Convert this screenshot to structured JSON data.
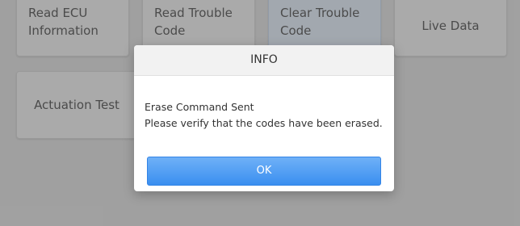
{
  "tiles": [
    {
      "label_line1": "Read ECU",
      "label_line2": "Information"
    },
    {
      "label_line1": "Read Trouble",
      "label_line2": "Code"
    },
    {
      "label_line1": "Clear Trouble",
      "label_line2": "Code"
    },
    {
      "label": "Live Data"
    },
    {
      "label": "Actuation Test"
    }
  ],
  "dialog": {
    "title": "INFO",
    "message_line1": "Erase Command Sent",
    "message_line2": "Please verify that the codes have been erased.",
    "ok_label": "OK"
  },
  "colors": {
    "ok_button": "#3a8ff0",
    "selected_tile": "#e9f1fb"
  }
}
